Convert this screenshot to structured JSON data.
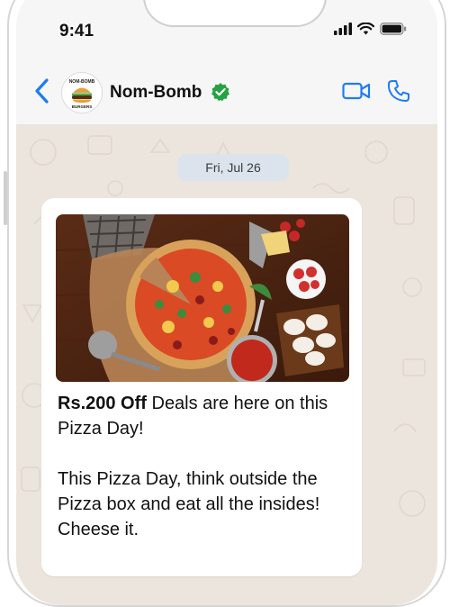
{
  "status_bar": {
    "time": "9:41"
  },
  "header": {
    "contact_name": "Nom-Bomb",
    "avatar_brand_text_top": "NOM-BOMB",
    "avatar_brand_text_bottom": "BURGERS"
  },
  "chat": {
    "date_label": "Fri, Jul 26",
    "message": {
      "highlight": "Rs.200 Off",
      "line1_rest": " Deals are here on this Pizza Day!",
      "body": "This Pizza Day, think outside the Pizza box and eat all the insides! Cheese it."
    }
  },
  "colors": {
    "accent_blue": "#1e7cf2",
    "verified_green": "#25a244",
    "chat_background": "#ece5dd",
    "date_pill": "#dbe3ec"
  },
  "icons": [
    "back-chevron-icon",
    "verified-badge-icon",
    "video-call-icon",
    "phone-call-icon",
    "signal-icon",
    "wifi-icon",
    "battery-icon"
  ]
}
